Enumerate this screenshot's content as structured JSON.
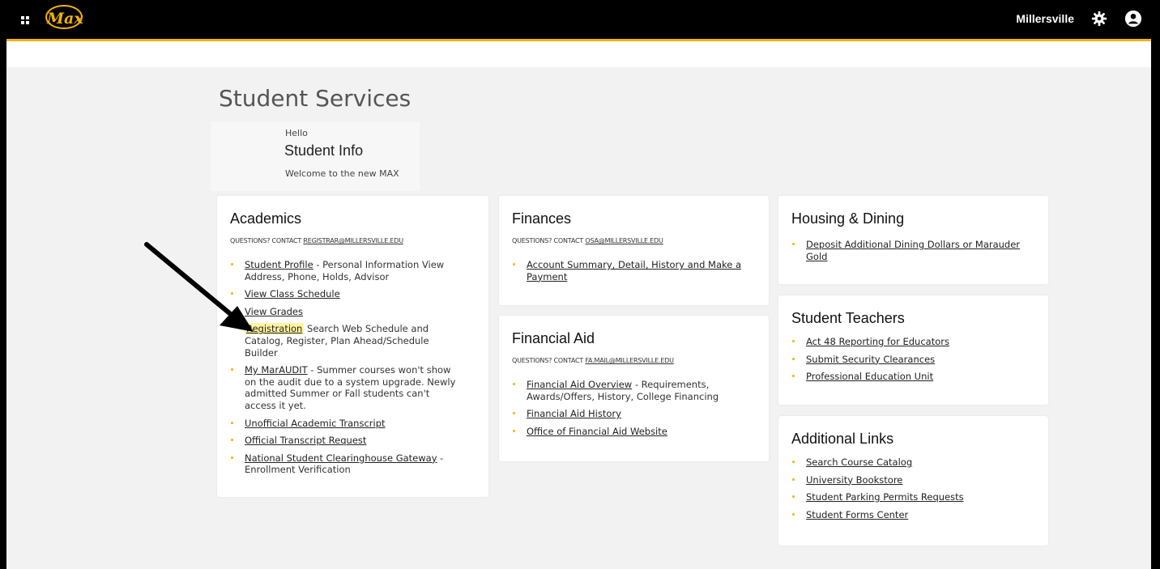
{
  "header": {
    "logo_text": "Max",
    "institution": "Millersville",
    "accent_color": "#f2b203",
    "icons": [
      "grid-menu-icon",
      "gear-icon",
      "user-icon"
    ]
  },
  "page": {
    "title": "Student Services",
    "hello": "Hello",
    "student_info": "Student Info",
    "welcome": "Welcome to the new MAX"
  },
  "academics": {
    "title": "Academics",
    "contact_prefix": "QUESTIONS? CONTACT",
    "contact_email": "REGISTRAR@MILLERSVILLE.EDU",
    "items": [
      {
        "link": "Student Profile",
        "desc": " - Personal Information View Address, Phone, Holds, Advisor"
      },
      {
        "link": "View Class Schedule",
        "desc": ""
      },
      {
        "link": "View Grades",
        "desc": ""
      },
      {
        "link": "Registration",
        "desc": " Search Web Schedule and Catalog, Register, Plan Ahead/Schedule Builder"
      },
      {
        "link": "My MarAUDIT",
        "desc": " - Summer courses won't show on the audit due to a system upgrade. Newly admitted Summer or Fall students can't access it yet."
      },
      {
        "link": "Unofficial Academic Transcript",
        "desc": ""
      },
      {
        "link": "Official Transcript Request",
        "desc": ""
      },
      {
        "link": "National Student Clearinghouse Gateway",
        "desc": " - Enrollment Verification"
      }
    ]
  },
  "finances": {
    "title": "Finances",
    "contact_prefix": "QUESTIONS? CONTACT",
    "contact_email": "OSA@MILLERSVILLE.EDU",
    "items": [
      {
        "link": "Account Summary, Detail, History and Make a Payment",
        "desc": ""
      }
    ]
  },
  "financial_aid": {
    "title": "Financial Aid",
    "contact_prefix": "QUESTIONS? CONTACT",
    "contact_email": "FA.MAIL@MILLERSVILLE.EDU",
    "items": [
      {
        "link": "Financial Aid Overview",
        "desc": " - Requirements, Awards/Offers, History, College Financing"
      },
      {
        "link": "Financial Aid History",
        "desc": ""
      },
      {
        "link": "Office of Financial Aid Website",
        "desc": ""
      }
    ]
  },
  "housing": {
    "title": "Housing & Dining",
    "items": [
      {
        "link": "Deposit Additional Dining Dollars or Marauder Gold",
        "desc": ""
      }
    ]
  },
  "student_teachers": {
    "title": "Student Teachers",
    "items": [
      {
        "link": "Act 48 Reporting for Educators",
        "desc": ""
      },
      {
        "link": "Submit Security Clearances",
        "desc": ""
      },
      {
        "link": "Professional Education Unit",
        "desc": ""
      }
    ]
  },
  "additional_links": {
    "title": "Additional Links",
    "items": [
      {
        "link": "Search Course Catalog",
        "desc": ""
      },
      {
        "link": "University Bookstore",
        "desc": ""
      },
      {
        "link": "Student Parking Permits Requests",
        "desc": ""
      },
      {
        "link": "Student Forms Center",
        "desc": ""
      }
    ]
  }
}
